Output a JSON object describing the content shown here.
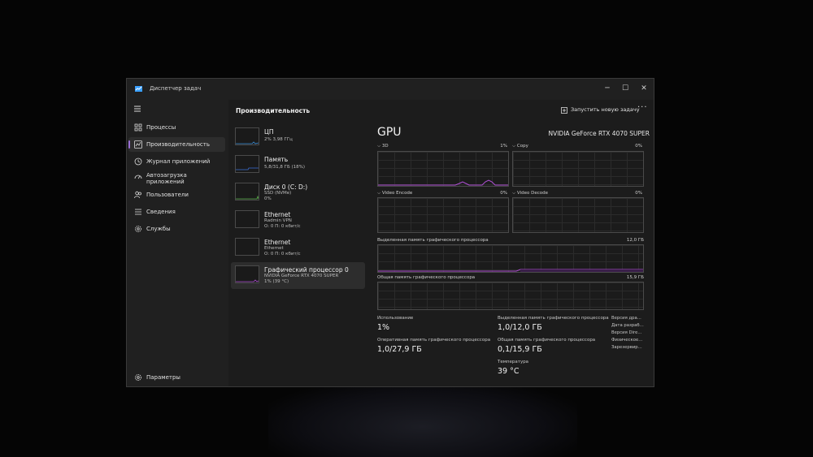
{
  "window": {
    "title": "Диспетчер задач"
  },
  "sidebar": {
    "items": [
      {
        "label": "Процессы"
      },
      {
        "label": "Производительность"
      },
      {
        "label": "Журнал приложений"
      },
      {
        "label": "Автозагрузка приложений"
      },
      {
        "label": "Пользователи"
      },
      {
        "label": "Сведения"
      },
      {
        "label": "Службы"
      }
    ],
    "settings": "Параметры"
  },
  "header": {
    "title": "Производительность",
    "run_task": "Запустить новую задачу"
  },
  "resources": [
    {
      "name": "ЦП",
      "sub1": "2% 3,98 ГГц",
      "sub2": ""
    },
    {
      "name": "Память",
      "sub1": "5,8/31,8 ГБ (18%)",
      "sub2": ""
    },
    {
      "name": "Диск 0 (C: D:)",
      "sub1": "SSD (NVMe)",
      "sub2": "0%"
    },
    {
      "name": "Ethernet",
      "sub1": "Radmin VPN",
      "sub2": "О: 0 П: 0 кбит/с"
    },
    {
      "name": "Ethernet",
      "sub1": "Ethernet",
      "sub2": "О: 0 П: 0 кбит/с"
    },
    {
      "name": "Графический процессор 0",
      "sub1": "NVIDIA GeForce RTX 4070 SUPER",
      "sub2": "1% (39 °C)"
    }
  ],
  "detail": {
    "heading": "GPU",
    "model": "NVIDIA GeForce RTX 4070 SUPER",
    "engines": [
      {
        "name": "3D",
        "pct": "1%"
      },
      {
        "name": "Copy",
        "pct": "0%"
      },
      {
        "name": "Video Encode",
        "pct": "0%"
      },
      {
        "name": "Video Decode",
        "pct": "0%"
      }
    ],
    "dedicated_label": "Выделенная память графического процессора",
    "dedicated_max": "12,0 ГБ",
    "shared_label": "Общая память графического процессора",
    "shared_max": "15,9 ГБ",
    "stats": {
      "usage_label": "Использование",
      "usage_value": "1%",
      "ram_label": "Оперативная память графического процессора",
      "ram_value": "1,0/27,9 ГБ",
      "ded_label": "Выделенная память графического процессора",
      "ded_value": "1,0/12,0 ГБ",
      "shared_label": "Общая память графического процессора",
      "shared_value": "0,1/15,9 ГБ",
      "temp_label": "Температура",
      "temp_value": "39 °C"
    },
    "info": [
      "Версия дра...",
      "Дата разраб...",
      "Версия Dire...",
      "Физическое...",
      "Зарезервир..."
    ]
  },
  "colors": {
    "accent": "#9a6fd6",
    "graph_line": "#b04fd6",
    "mem_line": "#3d6fd8"
  }
}
